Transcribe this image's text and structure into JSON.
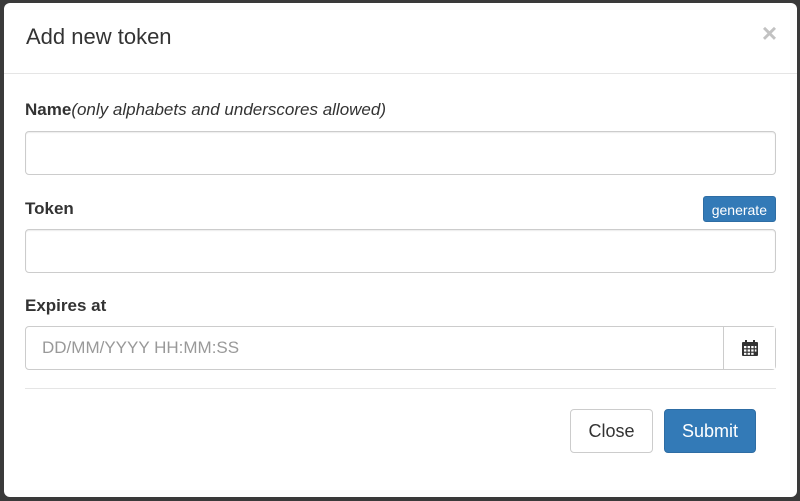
{
  "modal": {
    "title": "Add new token",
    "close_icon": "×"
  },
  "form": {
    "name_label": "Name",
    "name_hint": "(only alphabets and underscores allowed)",
    "name_value": "",
    "token_label": "Token",
    "token_value": "",
    "generate_label": "generate",
    "expires_label": "Expires at",
    "expires_placeholder": "DD/MM/YYYY HH:MM:SS",
    "calendar_icon": "calendar-icon"
  },
  "footer": {
    "close_label": "Close",
    "submit_label": "Submit"
  },
  "colors": {
    "primary": "#337ab7",
    "backdrop": "#3a3a3a"
  }
}
